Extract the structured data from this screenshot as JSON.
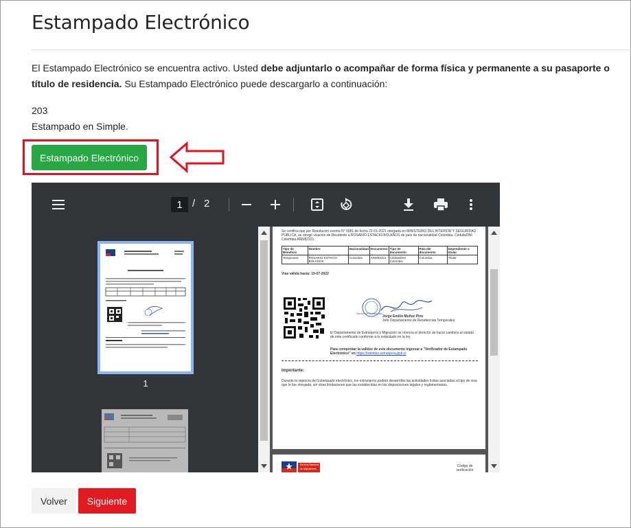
{
  "page": {
    "title": "Estampado Electrónico",
    "intro_prefix": "El Estampado Electrónico se encuentra activo. Usted ",
    "intro_bold": "debe adjuntarlo o acompañar de forma física y permanente a su pasaporte o título de residencia.",
    "intro_suffix": " Su Estampado Electrónico puede descargarlo a continuación:",
    "code": "203",
    "status": "Estampado en Simple."
  },
  "download_button": {
    "label": "Estampado Electrónico"
  },
  "annotation": {
    "highlight_color": "#e3101f"
  },
  "pdf_viewer": {
    "current_page": "1",
    "page_separator": "/",
    "total_pages": "2",
    "icons": [
      "menu-icon",
      "zoom-out-icon",
      "zoom-in-icon",
      "fit-page-icon",
      "rotate-icon",
      "download-icon",
      "print-icon",
      "more-options-icon"
    ],
    "thumbnail_label": "1",
    "document": {
      "cert_text": "Se certifica que por Resolución exenta N° 0081 de fecha 22-01-2021 otorgada en MINISTERIO DEL INTERIOR Y SEGURIDAD PÚBLICA, se otorgó visación de Residente a ROSARIO ESTACIO BOLAÑOS de país de nacionalidad Colombia, Cédula/DNI Colombia AR8/82321.",
      "table_headers": [
        "Tipo de Beneficio",
        "Nombre",
        "Nacionalidad",
        "Documento",
        "Tipo de documento",
        "País del documento",
        "Dependiente o titular"
      ],
      "table_row": [
        "Temporaria",
        "ROSARIO ESTACIO BOLAÑOS",
        "Colombia",
        "AR8/82321",
        "Cédula/DNI Colombia",
        "Colombia",
        "Titular"
      ],
      "validity": "Visa válida hasta: 19-07-2022",
      "signature_name": "Jorge Emilio Muñoz Pino",
      "signature_role": "Jefe Departamento de Residencias Temporales",
      "signature_stamp": "Sección de Residencias",
      "reserve_text": "El Departamento de Extranjería y Migración se reserva el derecho de hacer cambios al estado de este certificado conforme a lo estipulado en la ley.",
      "verify_text": "Para comprobar la validez de este documento ingresar a \"Verificador de Estampado Electrónico\" en ",
      "verify_link": "https://tramites.extranjeria.gob.cl",
      "important_title": "Importante:",
      "important_text": "Durante la vigencia del Estampado electrónico, los extranjeros podrán desarrollar las actividades lícitas asociadas al tipo de visa que le fue otorgada, sin otras limitaciones que las establecidas en las disposiciones legales y reglamentarias.",
      "page2_header": "Servicio Nacional de Migraciones",
      "page2_code": "Código de verificación"
    }
  },
  "footer": {
    "back_label": "Volver",
    "next_label": "Siguiente"
  }
}
